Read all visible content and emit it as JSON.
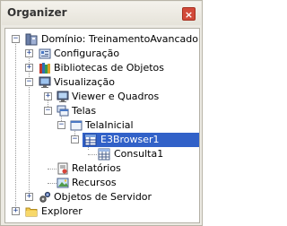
{
  "panel": {
    "title": "Organizer",
    "close_symbol": "×"
  },
  "tree": {
    "nodes": [
      {
        "label": "Domínio: TreinamentoAvancado",
        "icon": "domain-icon",
        "expander": "⊟"
      },
      {
        "label": "Configuração",
        "icon": "configuration-icon",
        "expander": "+"
      },
      {
        "label": "Bibliotecas de Objetos",
        "icon": "library-icon",
        "expander": "+"
      },
      {
        "label": "Visualização",
        "icon": "visualization-icon",
        "expander": "−"
      },
      {
        "label": "Viewer e Quadros",
        "icon": "viewer-icon",
        "expander": "+"
      },
      {
        "label": "Telas",
        "icon": "screens-icon",
        "expander": "−"
      },
      {
        "label": "TelaInicial",
        "icon": "screen-icon",
        "expander": "−"
      },
      {
        "label": "E3Browser1",
        "icon": "browser-icon",
        "expander": "−"
      },
      {
        "label": "Consulta1",
        "icon": "query-icon",
        "expander": ""
      },
      {
        "label": "Relatórios",
        "icon": "reports-icon",
        "expander": ""
      },
      {
        "label": "Recursos",
        "icon": "resources-icon",
        "expander": ""
      },
      {
        "label": "Objetos de Servidor",
        "icon": "server-objects-icon",
        "expander": "+"
      },
      {
        "label": "Explorer",
        "icon": "folder-icon",
        "expander": "+"
      }
    ]
  },
  "colors": {
    "selection": "#3161c8",
    "expander_sign": "#1f3f8f"
  }
}
